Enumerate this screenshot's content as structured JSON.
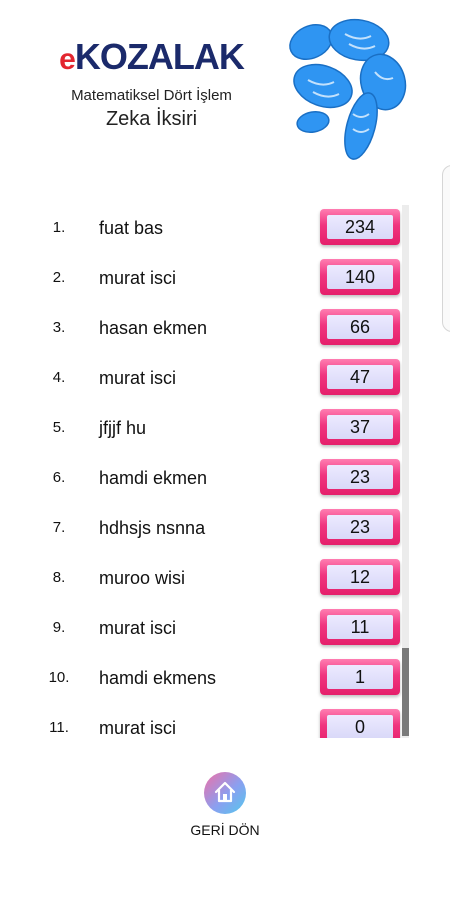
{
  "header": {
    "brand_e": "e",
    "brand_name": "KOZALAK",
    "subtitle": "Matematiksel Dört İşlem",
    "title": "Zeka İksiri",
    "colors": {
      "brand_blue": "#1b2a6b",
      "brand_red": "#e3262f",
      "cone_blue": "#2f95f2"
    }
  },
  "leaderboard": [
    {
      "rank": "1.",
      "name": "fuat bas",
      "score": "234"
    },
    {
      "rank": "2.",
      "name": "murat isci",
      "score": "140"
    },
    {
      "rank": "3.",
      "name": "hasan ekmen",
      "score": "66"
    },
    {
      "rank": "4.",
      "name": "murat isci",
      "score": "47"
    },
    {
      "rank": "5.",
      "name": "jfjjf hu",
      "score": "37"
    },
    {
      "rank": "6.",
      "name": "hamdi ekmen",
      "score": "23"
    },
    {
      "rank": "7.",
      "name": "hdhsjs nsnna",
      "score": "23"
    },
    {
      "rank": "8.",
      "name": "muroo wisi",
      "score": "12"
    },
    {
      "rank": "9.",
      "name": "murat isci",
      "score": "11"
    },
    {
      "rank": "10.",
      "name": "hamdi ekmens",
      "score": "1"
    },
    {
      "rank": "11.",
      "name": "murat isci",
      "score": "0"
    }
  ],
  "footer": {
    "back_label": "GERİ DÖN",
    "home_icon": "home-icon"
  },
  "colors": {
    "score_frame": "#f0357f",
    "score_fill": "#e2e1fb"
  }
}
